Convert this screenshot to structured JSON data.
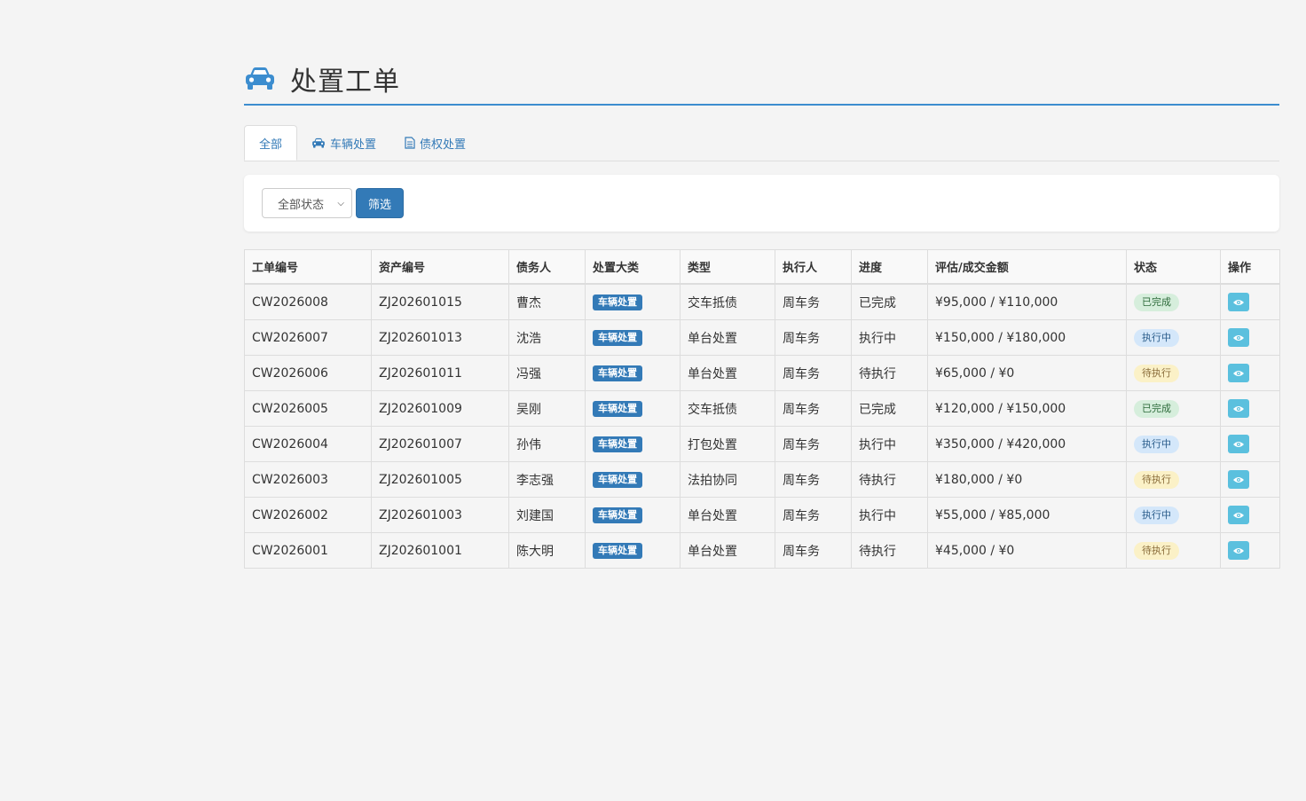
{
  "header": {
    "title": "处置工单",
    "icon": "car-icon",
    "accent": "#3c8dcf"
  },
  "tabs": [
    {
      "label": "全部",
      "icon": "",
      "active": true
    },
    {
      "label": "车辆处置",
      "icon": "car-icon",
      "active": false
    },
    {
      "label": "债权处置",
      "icon": "file-icon",
      "active": false
    }
  ],
  "filter": {
    "status_select": "全部状态",
    "filter_button": "筛选"
  },
  "table": {
    "columns": [
      "工单编号",
      "资产编号",
      "债务人",
      "处置大类",
      "类型",
      "执行人",
      "进度",
      "评估/成交金额",
      "状态",
      "操作"
    ],
    "rows": [
      {
        "id": "CW2026008",
        "asset": "ZJ202601015",
        "debtor": "曹杰",
        "category": "车辆处置",
        "type": "交车抵债",
        "executor": "周车务",
        "progress": "已完成",
        "amount": "¥95,000 / ¥110,000",
        "status": "已完成",
        "status_kind": "done"
      },
      {
        "id": "CW2026007",
        "asset": "ZJ202601013",
        "debtor": "沈浩",
        "category": "车辆处置",
        "type": "单台处置",
        "executor": "周车务",
        "progress": "执行中",
        "amount": "¥150,000 / ¥180,000",
        "status": "执行中",
        "status_kind": "doing"
      },
      {
        "id": "CW2026006",
        "asset": "ZJ202601011",
        "debtor": "冯强",
        "category": "车辆处置",
        "type": "单台处置",
        "executor": "周车务",
        "progress": "待执行",
        "amount": "¥65,000 / ¥0",
        "status": "待执行",
        "status_kind": "todo"
      },
      {
        "id": "CW2026005",
        "asset": "ZJ202601009",
        "debtor": "吴刚",
        "category": "车辆处置",
        "type": "交车抵债",
        "executor": "周车务",
        "progress": "已完成",
        "amount": "¥120,000 / ¥150,000",
        "status": "已完成",
        "status_kind": "done"
      },
      {
        "id": "CW2026004",
        "asset": "ZJ202601007",
        "debtor": "孙伟",
        "category": "车辆处置",
        "type": "打包处置",
        "executor": "周车务",
        "progress": "执行中",
        "amount": "¥350,000 / ¥420,000",
        "status": "执行中",
        "status_kind": "doing"
      },
      {
        "id": "CW2026003",
        "asset": "ZJ202601005",
        "debtor": "李志强",
        "category": "车辆处置",
        "type": "法拍协同",
        "executor": "周车务",
        "progress": "待执行",
        "amount": "¥180,000 / ¥0",
        "status": "待执行",
        "status_kind": "todo"
      },
      {
        "id": "CW2026002",
        "asset": "ZJ202601003",
        "debtor": "刘建国",
        "category": "车辆处置",
        "type": "单台处置",
        "executor": "周车务",
        "progress": "执行中",
        "amount": "¥55,000 / ¥85,000",
        "status": "执行中",
        "status_kind": "doing"
      },
      {
        "id": "CW2026001",
        "asset": "ZJ202601001",
        "debtor": "陈大明",
        "category": "车辆处置",
        "type": "单台处置",
        "executor": "周车务",
        "progress": "待执行",
        "amount": "¥45,000 / ¥0",
        "status": "待执行",
        "status_kind": "todo"
      }
    ],
    "view_icon": "eye-icon"
  }
}
